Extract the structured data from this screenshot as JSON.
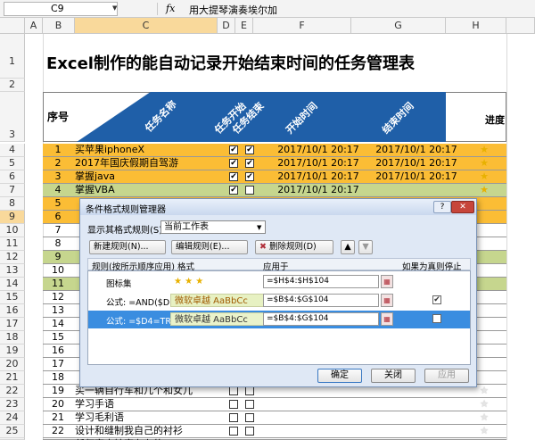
{
  "formula_bar": {
    "name_box": "C9",
    "fx_label": "fx",
    "content": "用大提琴演奏埃尔加"
  },
  "columns": [
    "A",
    "B",
    "C",
    "D",
    "E",
    "F",
    "G",
    "H"
  ],
  "selected_column": "C",
  "selected_row": "9",
  "sheet": {
    "title": "Excel制作的能自动记录开始结束时间的任务管理表",
    "header": {
      "seq": "序号",
      "task_name": "任务名称",
      "task_start": "任务开始",
      "task_end": "任务结束",
      "start_time": "开始时间",
      "end_time": "结束时间",
      "progress": "进度"
    },
    "row_numbers_top": [
      "1",
      "2",
      "3"
    ],
    "rows": [
      {
        "row": "4",
        "num": "1",
        "name": "买苹果iphoneX",
        "c1": "✔",
        "c2": "✔",
        "t1": "2017/10/1 20:17",
        "t2": "2017/10/1 20:17",
        "star": "★",
        "fill": "orange"
      },
      {
        "row": "5",
        "num": "2",
        "name": "2017年国庆假期自驾游",
        "c1": "✔",
        "c2": "✔",
        "t1": "2017/10/1 20:17",
        "t2": "2017/10/1 20:17",
        "star": "★",
        "fill": "orange"
      },
      {
        "row": "6",
        "num": "3",
        "name": "掌握java",
        "c1": "✔",
        "c2": "✔",
        "t1": "2017/10/1 20:17",
        "t2": "2017/10/1 20:17",
        "star": "★",
        "fill": "orange"
      },
      {
        "row": "7",
        "num": "4",
        "name": "掌握VBA",
        "c1": "✔",
        "c2": "",
        "t1": "2017/10/1 20:17",
        "t2": "",
        "star": "★",
        "fill": "green"
      }
    ],
    "partial_rows": [
      {
        "row": "8",
        "num": "5",
        "fill": "orange"
      },
      {
        "row": "9",
        "num": "6",
        "fill": "orange"
      },
      {
        "row": "10",
        "num": "7",
        "fill": "none"
      },
      {
        "row": "11",
        "num": "8",
        "fill": "none"
      },
      {
        "row": "12",
        "num": "9",
        "fill": "green"
      },
      {
        "row": "13",
        "num": "10",
        "fill": "none"
      },
      {
        "row": "14",
        "num": "11",
        "fill": "green"
      },
      {
        "row": "15",
        "num": "12",
        "fill": "none"
      },
      {
        "row": "16",
        "num": "13",
        "fill": "none"
      },
      {
        "row": "17",
        "num": "14",
        "fill": "none"
      },
      {
        "row": "18",
        "num": "15",
        "fill": "none"
      },
      {
        "row": "19",
        "num": "16",
        "fill": "none"
      },
      {
        "row": "20",
        "num": "17",
        "fill": "none"
      },
      {
        "row": "21",
        "num": "18",
        "fill": "none"
      }
    ],
    "bottom_rows": [
      {
        "row": "22",
        "num": "19",
        "name": "买一辆自行车和几个和女儿"
      },
      {
        "row": "23",
        "num": "20",
        "name": "学习手语"
      },
      {
        "row": "24",
        "num": "21",
        "name": "学习毛利语"
      },
      {
        "row": "25",
        "num": "22",
        "name": "设计和缝制我自己的衬衫"
      },
      {
        "row": "26",
        "num": "23",
        "name": "任何家中妨害存在的"
      }
    ]
  },
  "dialog": {
    "title": "条件格式规则管理器",
    "help": "?",
    "close": "✕",
    "show_label": "显示其格式规则(S):",
    "show_value": "当前工作表",
    "buttons": {
      "new": "新建规则(N)...",
      "edit": "编辑规则(E)...",
      "delete": "删除规则(D)",
      "up": "▲",
      "down": "▼"
    },
    "columns": {
      "rule": "规则(按所示顺序应用)",
      "format": "格式",
      "applies_to": "应用于",
      "stop_if_true": "如果为真则停止"
    },
    "rules": [
      {
        "name": "图标集",
        "format": "★ ★ ★",
        "applies_to": "=$H$4:$H$104",
        "stop": ""
      },
      {
        "name": "公式: =AND($D...",
        "format": "微软卓越  AaBbCc",
        "applies_to": "=$B$4:$G$104",
        "stop": "✔"
      },
      {
        "name": "公式: =$D4=TRUE",
        "format": "微软卓越  AaBbCc",
        "applies_to": "=$B$4:$G$104",
        "stop": ""
      }
    ],
    "selected_rule": 2,
    "ok": "确定",
    "close_btn": "关闭",
    "apply": "应用"
  }
}
